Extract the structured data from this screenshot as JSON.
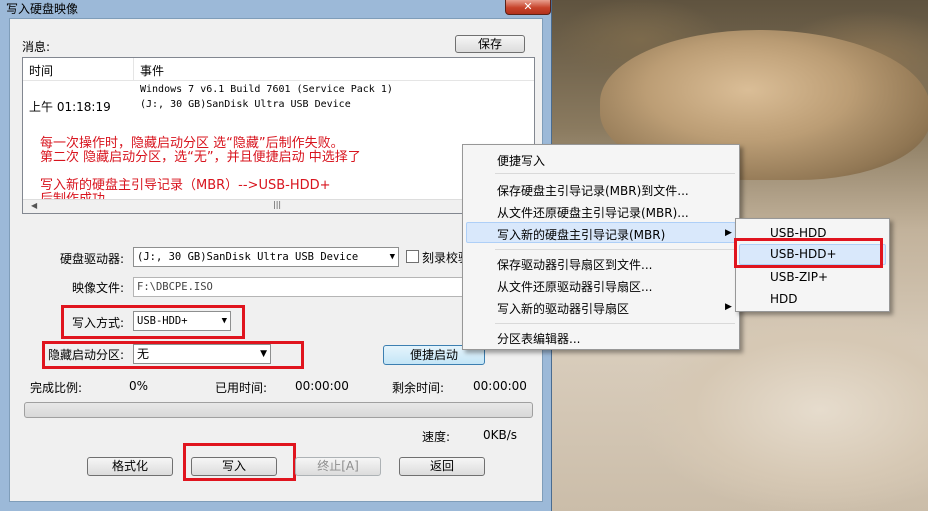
{
  "window": {
    "title": "写入硬盘映像",
    "close": "✕"
  },
  "messages": {
    "label": "消息:",
    "save_button": "保存",
    "columns": [
      "时间",
      "事件"
    ],
    "entries": [
      {
        "line1": "Windows 7 v6.1 Build 7601 (Service Pack 1)"
      },
      {
        "time": "上午 01:18:19",
        "event": "(J:, 30 GB)SanDisk Ultra USB Device"
      }
    ],
    "notes": [
      "每一次操作时，隐藏启动分区 选“隐藏”后制作失败。",
      "第二次 隐藏启动分区，选“无”，并且便捷启动 中选择了",
      "写入新的硬盘主引导记录（MBR）-->USB-HDD+",
      "后制作成功"
    ],
    "scroll_thumb": "|||"
  },
  "form": {
    "drive_label": "硬盘驱动器:",
    "drive_value": "(J:, 30 GB)SanDisk Ultra USB Device",
    "verify_label": "刻录校验",
    "image_label": "映像文件:",
    "image_value": "F:\\DBCPE.ISO",
    "write_mode_label": "写入方式:",
    "write_mode_value": "USB-HDD+",
    "hidden_label": "隐藏启动分区:",
    "hidden_value": "无",
    "quick_boot_button": "便捷启动"
  },
  "status": {
    "complete_label": "完成比例:",
    "complete_value": "0%",
    "elapsed_label": "已用时间:",
    "elapsed_value": "00:00:00",
    "remaining_label": "剩余时间:",
    "remaining_value": "00:00:00",
    "speed_label": "速度:",
    "speed_value": "0KB/s",
    "progress": 0
  },
  "buttons": {
    "format": "格式化",
    "write": "写入",
    "stop": "终止[A]",
    "back": "返回"
  },
  "context_menu": {
    "items": [
      "便捷写入",
      "保存硬盘主引导记录(MBR)到文件...",
      "从文件还原硬盘主引导记录(MBR)...",
      "写入新的硬盘主引导记录(MBR)",
      "保存驱动器引导扇区到文件...",
      "从文件还原驱动器引导扇区...",
      "写入新的驱动器引导扇区",
      "分区表编辑器..."
    ],
    "submenu_arrow": "▶",
    "submenu": [
      "USB-HDD",
      "USB-HDD+",
      "USB-ZIP+",
      "HDD"
    ]
  },
  "colors": {
    "annotation_red": "#e0141e",
    "note_text": "#d8141e",
    "menu_highlight": "#d9e8fb"
  }
}
